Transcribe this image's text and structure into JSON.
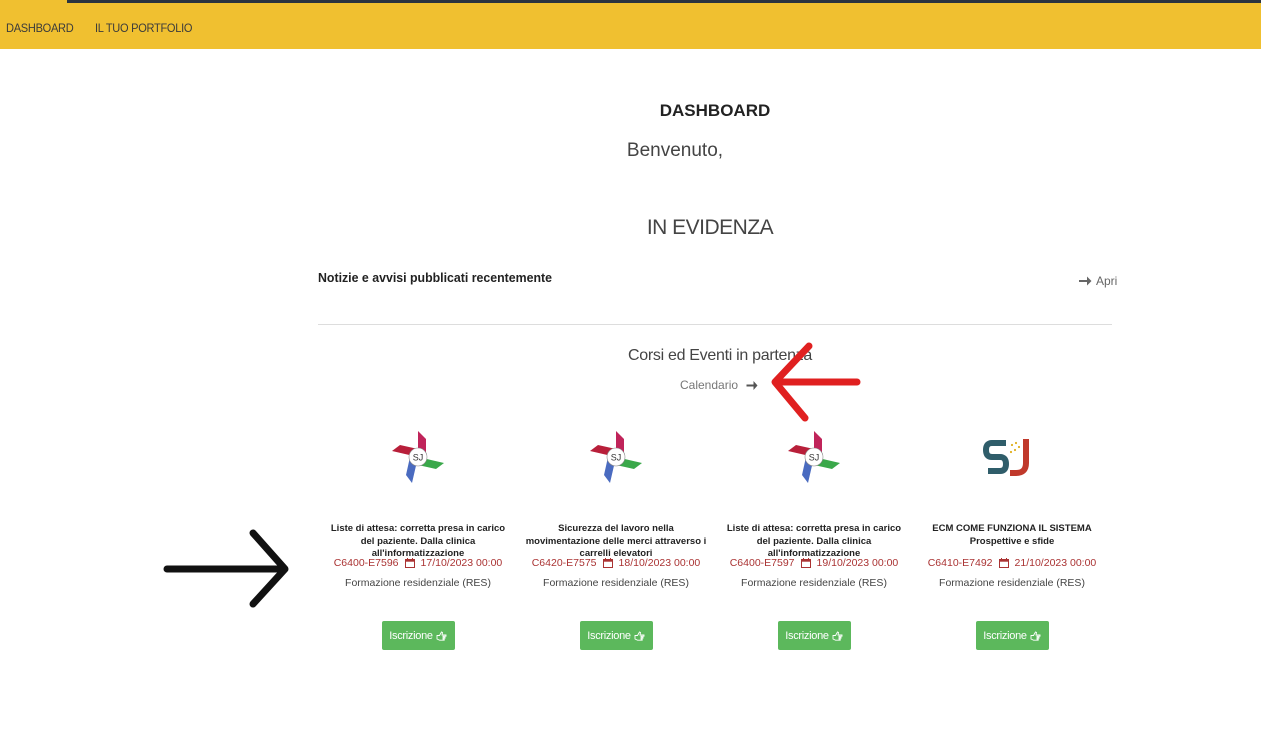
{
  "nav": {
    "items": [
      {
        "label": "DASHBOARD"
      },
      {
        "label": "IL TUO PORTFOLIO"
      }
    ]
  },
  "main": {
    "title": "DASHBOARD",
    "welcome": "Benvenuto,",
    "highlight": "IN EVIDENZA",
    "news_title": "Notizie e avvisi pubblicati recentemente",
    "open_label": "Apri",
    "events_title": "Corsi ed Eventi in partenza",
    "calendar_label": "Calendario"
  },
  "courses": [
    {
      "title": "Liste di attesa: corretta presa in carico del paziente. Dalla clinica all'informatizzazione",
      "code": "C6400-E7596",
      "date": "17/10/2023 00:00",
      "type": "Formazione residenziale (RES)",
      "button": "Iscrizione",
      "logo": "pinwheel-logo-icon"
    },
    {
      "title": "Sicurezza del lavoro nella movimentazione delle merci attraverso i carrelli elevatori",
      "code": "C6420-E7575",
      "date": "18/10/2023 00:00",
      "type": "Formazione residenziale (RES)",
      "button": "Iscrizione",
      "logo": "pinwheel-logo-icon"
    },
    {
      "title": "Liste di attesa: corretta presa in carico del paziente. Dalla clinica all'informatizzazione",
      "code": "C6400-E7597",
      "date": "19/10/2023 00:00",
      "type": "Formazione residenziale (RES)",
      "button": "Iscrizione",
      "logo": "pinwheel-logo-icon"
    },
    {
      "title": "ECM COME FUNZIONA IL SISTEMA Prospettive e sfide",
      "code": "C6410-E7492",
      "date": "21/10/2023 00:00",
      "type": "Formazione residenziale (RES)",
      "button": "Iscrizione",
      "logo": "sj-logo-icon"
    }
  ],
  "colors": {
    "topbar": "#f0c030",
    "button": "#5cb85c",
    "course_meta": "#aa3333",
    "annotation_red": "#e02020",
    "annotation_black": "#111111"
  }
}
